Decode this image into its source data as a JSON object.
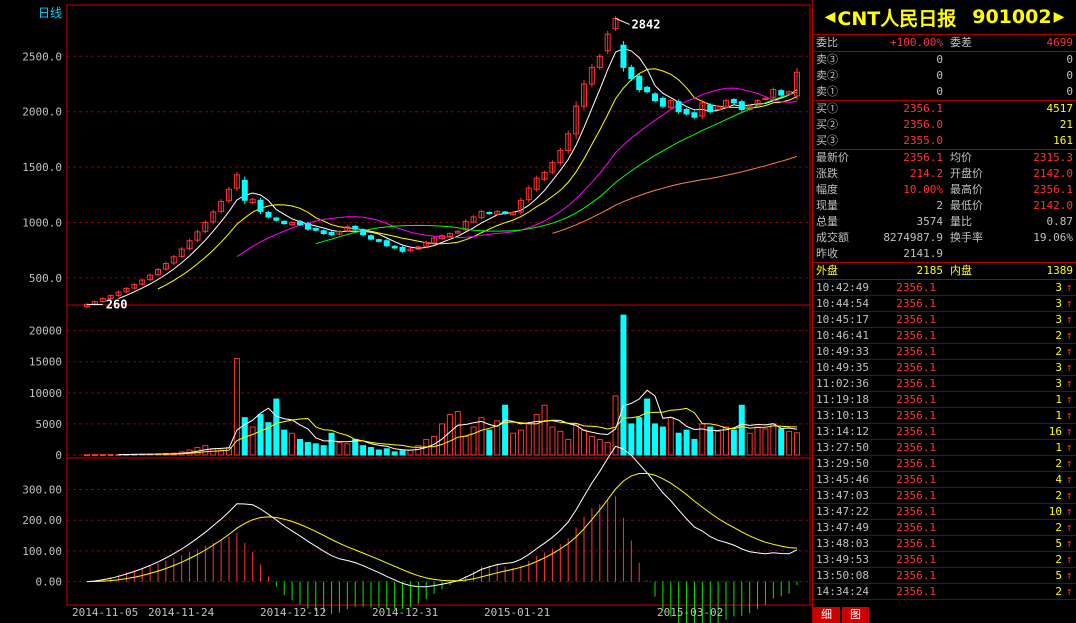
{
  "chart_data": [
    {
      "type": "candlestick",
      "title": "日线",
      "ylim": [
        300,
        2900
      ],
      "yticks": [
        "2500.0",
        "2000.0",
        "1500.0",
        "1000.0",
        "500.0"
      ],
      "ytick_values": [
        2500,
        2000,
        1500,
        1000,
        500
      ],
      "annotations": [
        {
          "label": "260",
          "value": 260
        },
        {
          "label": "2842",
          "value": 2842
        }
      ],
      "close": [
        260,
        285,
        312,
        340,
        372,
        405,
        440,
        480,
        525,
        575,
        630,
        690,
        760,
        835,
        915,
        1000,
        1095,
        1190,
        1300,
        1430,
        1200,
        1210,
        1100,
        1050,
        1020,
        990,
        1000,
        980,
        940,
        930,
        900,
        890,
        920,
        960,
        940,
        890,
        850,
        830,
        790,
        770,
        740,
        760,
        780,
        820,
        860,
        880,
        900,
        920,
        1010,
        1050,
        1100,
        1080,
        1100,
        1080,
        1090,
        1200,
        1310,
        1400,
        1450,
        1540,
        1650,
        1800,
        2050,
        2250,
        2400,
        2500,
        2700,
        2842,
        2400,
        2300,
        2200,
        2180,
        2100,
        2050,
        2100,
        2000,
        1980,
        1950,
        2080,
        2000,
        2050,
        2100,
        2080,
        2020,
        2050,
        2100,
        2120,
        2200,
        2150,
        2180,
        2356
      ],
      "open": [
        240,
        262,
        287,
        314,
        342,
        374,
        408,
        443,
        484,
        528,
        579,
        634,
        694,
        764,
        840,
        920,
        1005,
        1100,
        1196,
        1310,
        1380,
        1180,
        1200,
        1090,
        1040,
        1010,
        980,
        1010,
        990,
        945,
        925,
        910,
        895,
        925,
        965,
        935,
        880,
        845,
        835,
        785,
        775,
        745,
        760,
        785,
        815,
        855,
        875,
        905,
        935,
        1005,
        1045,
        1090,
        1075,
        1095,
        1070,
        1095,
        1205,
        1300,
        1390,
        1455,
        1540,
        1650,
        1800,
        2050,
        2250,
        2400,
        2550,
        2750,
        2600,
        2400,
        2320,
        2220,
        2160,
        2120,
        2040,
        2090,
        2020,
        1990,
        1960,
        2060,
        2020,
        2040,
        2110,
        2090,
        2020,
        2060,
        2110,
        2130,
        2190,
        2160,
        2142
      ],
      "ma_series": [
        {
          "name": "ma5",
          "color": "#ffffff"
        },
        {
          "name": "ma10",
          "color": "#ffff00"
        },
        {
          "name": "ma20",
          "color": "#ff00ff"
        },
        {
          "name": "ma30",
          "color": "#00ff00"
        },
        {
          "name": "ma60",
          "color": "#ff8040"
        }
      ]
    },
    {
      "type": "bar",
      "title": "volume",
      "ylim": [
        0,
        23000
      ],
      "yticks": [
        "20000",
        "15000",
        "10000",
        "5000",
        "0"
      ],
      "ytick_values": [
        20000,
        15000,
        10000,
        5000,
        0
      ],
      "values": [
        50,
        60,
        70,
        80,
        90,
        100,
        120,
        150,
        180,
        200,
        250,
        300,
        500,
        800,
        1200,
        1500,
        1000,
        800,
        1200,
        15500,
        6000,
        4500,
        6500,
        5200,
        9000,
        4000,
        3500,
        2500,
        2000,
        1800,
        1500,
        3500,
        2000,
        1800,
        2500,
        1500,
        1200,
        800,
        1000,
        500,
        700,
        800,
        1500,
        2500,
        3000,
        5000,
        6500,
        7000,
        3000,
        4500,
        6000,
        4000,
        5500,
        8000,
        3500,
        4000,
        5000,
        6500,
        8000,
        4500,
        3800,
        2500,
        5000,
        4000,
        3000,
        2500,
        2000,
        9500,
        22500,
        5000,
        6000,
        9000,
        5000,
        4500,
        6000,
        3500,
        4000,
        2500,
        5000,
        4500,
        3800,
        4500,
        4000,
        8000,
        3500,
        4500,
        4200,
        5000,
        4200,
        3800,
        3574
      ]
    },
    {
      "type": "line",
      "title": "MACD",
      "ylim": [
        -60,
        380
      ],
      "yticks": [
        "300.00",
        "200.00",
        "100.00",
        "0.00"
      ],
      "ytick_values": [
        300,
        200,
        100,
        0
      ]
    },
    {
      "type": "axis",
      "x_labels": [
        "2014-11-05",
        "2014-11-24",
        "2014-12-12",
        "2014-12-31",
        "2015-01-21",
        "2015-03-02"
      ]
    }
  ],
  "quote": {
    "name": "CNT人民日报",
    "code": "901002",
    "left_arrow": "◀",
    "right_arrow": "▶",
    "weibi_label": "委比",
    "weibi": "+100.00%",
    "weicha_label": "委差",
    "weicha": "4699",
    "sell": [
      {
        "label": "卖③",
        "price": "0",
        "vol": "0"
      },
      {
        "label": "卖②",
        "price": "0",
        "vol": "0"
      },
      {
        "label": "卖①",
        "price": "0",
        "vol": "0"
      }
    ],
    "buy": [
      {
        "label": "买①",
        "price": "2356.1",
        "vol": "4517"
      },
      {
        "label": "买②",
        "price": "2356.0",
        "vol": "21"
      },
      {
        "label": "买③",
        "price": "2355.0",
        "vol": "161"
      }
    ],
    "stats": [
      {
        "l1": "最新价",
        "v1": "2356.1",
        "c1": "r",
        "l2": "均价",
        "v2": "2315.3",
        "c2": "r"
      },
      {
        "l1": "涨跌",
        "v1": "214.2",
        "c1": "r",
        "l2": "开盘价",
        "v2": "2142.0",
        "c2": "r"
      },
      {
        "l1": "幅度",
        "v1": "10.00%",
        "c1": "r",
        "l2": "最高价",
        "v2": "2356.1",
        "c2": "r"
      },
      {
        "l1": "现量",
        "v1": "2",
        "c1": "w",
        "l2": "最低价",
        "v2": "2142.0",
        "c2": "r"
      },
      {
        "l1": "总量",
        "v1": "3574",
        "c1": "w",
        "l2": "量比",
        "v2": "0.87",
        "c2": "w"
      },
      {
        "l1": "成交额",
        "v1": "8274987.9",
        "c1": "w",
        "l2": "换手率",
        "v2": "19.06%",
        "c2": "w"
      },
      {
        "l1": "昨收",
        "v1": "2141.9",
        "c1": "w",
        "l2": "",
        "v2": "",
        "c2": "w"
      }
    ],
    "waipan_label": "外盘",
    "waipan": "2185",
    "neipan_label": "内盘",
    "neipan": "1389",
    "ticks": [
      {
        "t": "10:42:49",
        "p": "2356.1",
        "v": "3",
        "d": "↑"
      },
      {
        "t": "10:44:54",
        "p": "2356.1",
        "v": "3",
        "d": "↑"
      },
      {
        "t": "10:45:17",
        "p": "2356.1",
        "v": "3",
        "d": "↑"
      },
      {
        "t": "10:46:41",
        "p": "2356.1",
        "v": "2",
        "d": "↑"
      },
      {
        "t": "10:49:33",
        "p": "2356.1",
        "v": "2",
        "d": "↑"
      },
      {
        "t": "10:49:35",
        "p": "2356.1",
        "v": "3",
        "d": "↑"
      },
      {
        "t": "11:02:36",
        "p": "2356.1",
        "v": "3",
        "d": "↑"
      },
      {
        "t": "11:19:18",
        "p": "2356.1",
        "v": "1",
        "d": "↑"
      },
      {
        "t": "13:10:13",
        "p": "2356.1",
        "v": "1",
        "d": "↑"
      },
      {
        "t": "13:14:12",
        "p": "2356.1",
        "v": "16",
        "d": "↑"
      },
      {
        "t": "13:27:50",
        "p": "2356.1",
        "v": "1",
        "d": "↑"
      },
      {
        "t": "13:29:50",
        "p": "2356.1",
        "v": "2",
        "d": "↑"
      },
      {
        "t": "13:45:46",
        "p": "2356.1",
        "v": "4",
        "d": "↑"
      },
      {
        "t": "13:47:03",
        "p": "2356.1",
        "v": "2",
        "d": "↑"
      },
      {
        "t": "13:47:22",
        "p": "2356.1",
        "v": "10",
        "d": "↑"
      },
      {
        "t": "13:47:49",
        "p": "2356.1",
        "v": "2",
        "d": "↑"
      },
      {
        "t": "13:48:03",
        "p": "2356.1",
        "v": "5",
        "d": "↑"
      },
      {
        "t": "13:49:53",
        "p": "2356.1",
        "v": "2",
        "d": "↑"
      },
      {
        "t": "13:50:08",
        "p": "2356.1",
        "v": "5",
        "d": "↑"
      },
      {
        "t": "14:34:24",
        "p": "2356.1",
        "v": "2",
        "d": "↑"
      }
    ],
    "tabs": [
      "细",
      "图"
    ]
  }
}
